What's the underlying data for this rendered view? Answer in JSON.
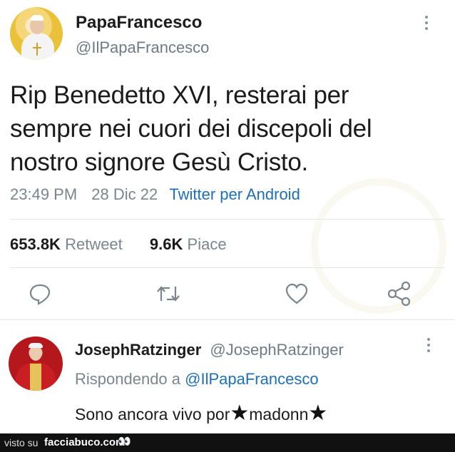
{
  "tweet": {
    "author_name": "PapaFrancesco",
    "author_handle": "@IlPapaFrancesco",
    "text_lines": [
      "Rip Benedetto XVI, resterai per",
      "sempre nei cuori dei discepoli del",
      "nostro signore Gesù Cristo."
    ],
    "time": "23:49 PM",
    "date": "28 Dic 22",
    "source": "Twitter per Android",
    "retweets_value": "653.8K",
    "retweets_label": "Retweet",
    "likes_value": "9.6K",
    "likes_label": "Piace",
    "action_icons": [
      "reply-icon",
      "retweet-icon",
      "heart-icon",
      "share-icon"
    ]
  },
  "reply": {
    "author_name": "JosephRatzinger",
    "author_handle": "@JosephRatzinger",
    "replying_prefix": "Rispondendo a",
    "replying_mention": "@IlPapaFrancesco",
    "text_start": "Sono ancora vivo por",
    "text_middle": "madonn",
    "censor_glyph": "★"
  },
  "watermark": {
    "prefix": "visto su",
    "site": "facciabuco.com",
    "eyes": "👀"
  },
  "colors": {
    "link": "#1d6fb8",
    "muted": "#7a858e",
    "text": "#1b1b1b"
  }
}
